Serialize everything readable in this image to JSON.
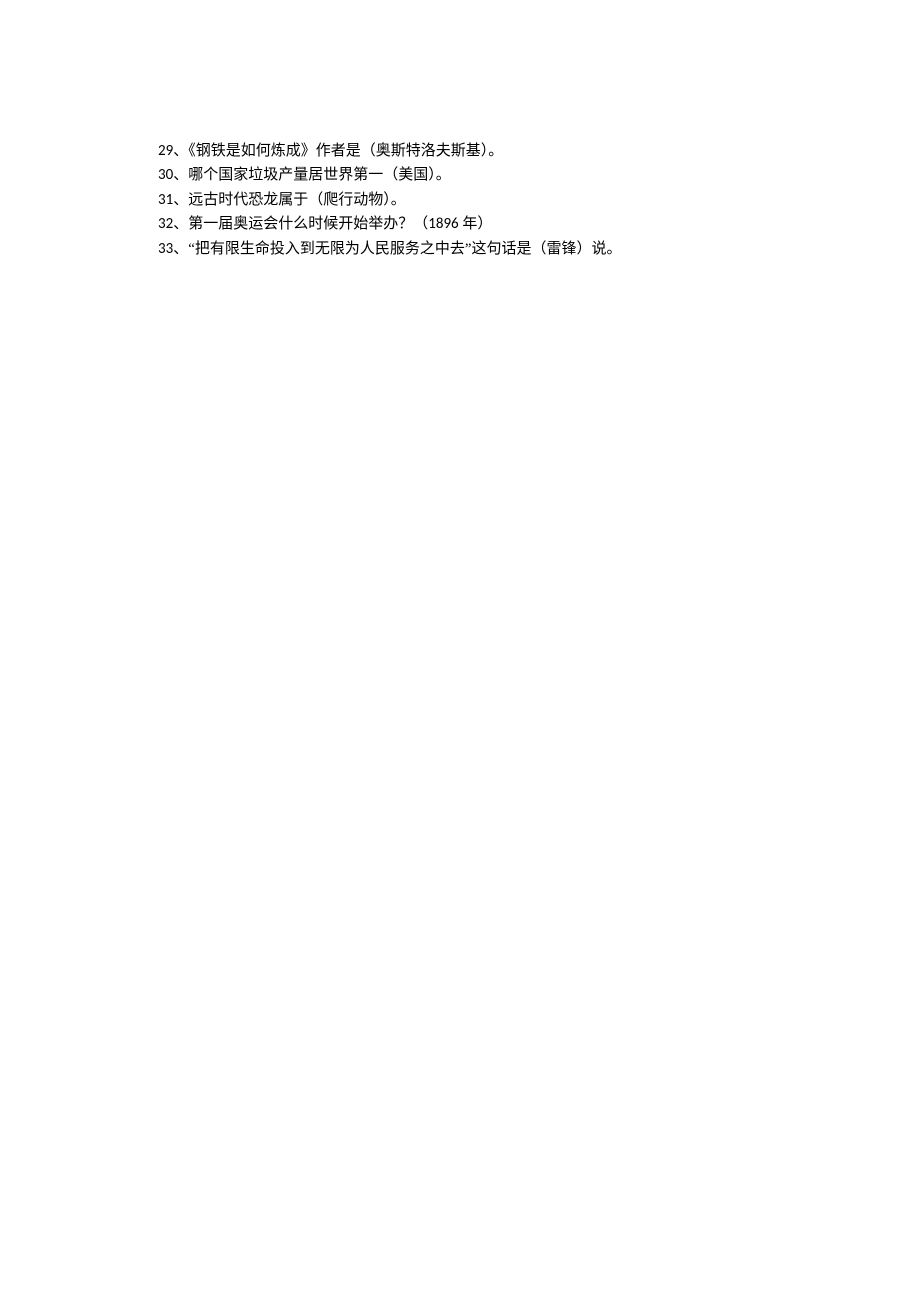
{
  "lines": [
    {
      "num": "29",
      "sep": "、",
      "text": "《钢铁是如何炼成》作者是（奥斯特洛夫斯基）。"
    },
    {
      "num": "30",
      "sep": "、",
      "text": "哪个国家垃圾产量居世界第一（美国）。"
    },
    {
      "num": "31",
      "sep": "、",
      "text": "远古时代恐龙属于（爬行动物）。"
    },
    {
      "num": "32",
      "sep": "、",
      "text_before": "第一届奥运会什么时候开始举办？（",
      "year": "1896",
      "text_after": " 年）"
    },
    {
      "num": "33",
      "sep": "、",
      "text": "“把有限生命投入到无限为人民服务之中去”这句话是（雷锋）说。"
    }
  ]
}
